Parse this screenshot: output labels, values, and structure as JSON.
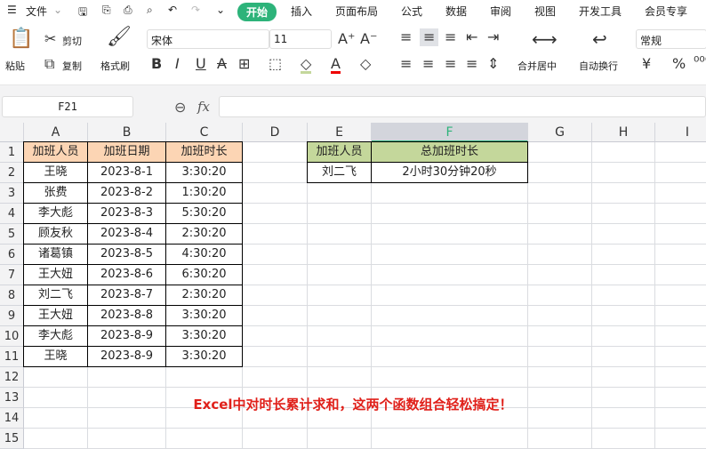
{
  "menu": {
    "file": "文件",
    "tabs": [
      "开始",
      "插入",
      "页面布局",
      "公式",
      "数据",
      "审阅",
      "视图",
      "开发工具",
      "会员专享"
    ]
  },
  "ribbon": {
    "paste": "粘贴",
    "cut": "剪切",
    "copy": "复制",
    "format_painter": "格式刷",
    "font": "宋体",
    "size": "11",
    "merge": "合并居中",
    "wrap": "自动换行",
    "number_format": "常规"
  },
  "formula": {
    "name_box": "F21",
    "fx": "fx",
    "value": ""
  },
  "columns": [
    "A",
    "B",
    "C",
    "D",
    "E",
    "F",
    "G",
    "H",
    "I"
  ],
  "rows": [
    "1",
    "2",
    "3",
    "4",
    "5",
    "6",
    "7",
    "8",
    "9",
    "10",
    "11",
    "12",
    "13",
    "14",
    "15"
  ],
  "table1": {
    "headers": [
      "加班人员",
      "加班日期",
      "加班时长"
    ],
    "rows": [
      [
        "王晓",
        "2023-8-1",
        "3:30:20"
      ],
      [
        "张费",
        "2023-8-2",
        "1:30:20"
      ],
      [
        "李大彪",
        "2023-8-3",
        "5:30:20"
      ],
      [
        "顾友秋",
        "2023-8-4",
        "2:30:20"
      ],
      [
        "诸葛镇",
        "2023-8-5",
        "4:30:20"
      ],
      [
        "王大妞",
        "2023-8-6",
        "6:30:20"
      ],
      [
        "刘二飞",
        "2023-8-7",
        "2:30:20"
      ],
      [
        "王大妞",
        "2023-8-8",
        "3:30:20"
      ],
      [
        "李大彪",
        "2023-8-9",
        "3:30:20"
      ],
      [
        "王晓",
        "2023-8-9",
        "3:30:20"
      ]
    ]
  },
  "table2": {
    "headers": [
      "加班人员",
      "总加班时长"
    ],
    "rows": [
      [
        "刘二飞",
        "2小时30分钟20秒"
      ]
    ]
  },
  "caption": "Excel中对时长累计求和，这两个函数组合轻松搞定！",
  "colors": {
    "accent": "#2db37a",
    "header1": "#fcd5b4",
    "header2": "#c4d79b",
    "caption": "#e0201a"
  }
}
